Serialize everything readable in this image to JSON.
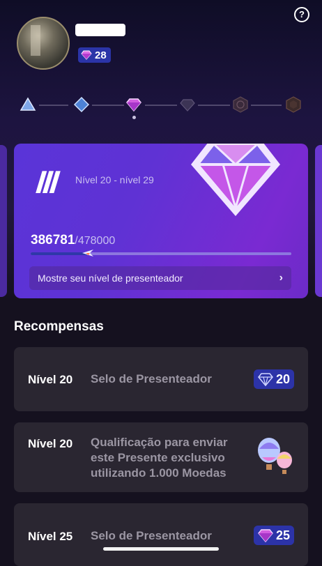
{
  "header": {
    "help_icon": "question-circle-icon",
    "coin_count": "28"
  },
  "level_track": {
    "icons": [
      "triangle-tier-icon",
      "blue-gem-tier-icon",
      "pink-gem-tier-icon",
      "dark-gem-tier-icon",
      "hexagon-tier-icon",
      "hexagon-ring-tier-icon"
    ]
  },
  "level_card": {
    "roman": "III",
    "range": "Nível 20 - nível 29",
    "current": "386781",
    "total": "/478000",
    "progress_fraction": 0.22,
    "show_button": "Mostre seu nível de presenteador"
  },
  "rewards": {
    "title": "Recompensas",
    "items": [
      {
        "level": "Nível 20",
        "desc": "Selo de Presenteador",
        "badge": "20"
      },
      {
        "level": "Nível 20",
        "desc_lines": [
          "Qualificação para enviar",
          "este Presente exclusivo",
          "utilizando 1.000 Moedas"
        ]
      },
      {
        "level": "Nível 25",
        "desc": "Selo de Presenteador",
        "badge": "25"
      }
    ]
  },
  "colors": {
    "accent": "#5a34d8",
    "badge_blue": "#2c33a8",
    "card_bg": "#2a2631",
    "page_bg": "#15111f"
  }
}
